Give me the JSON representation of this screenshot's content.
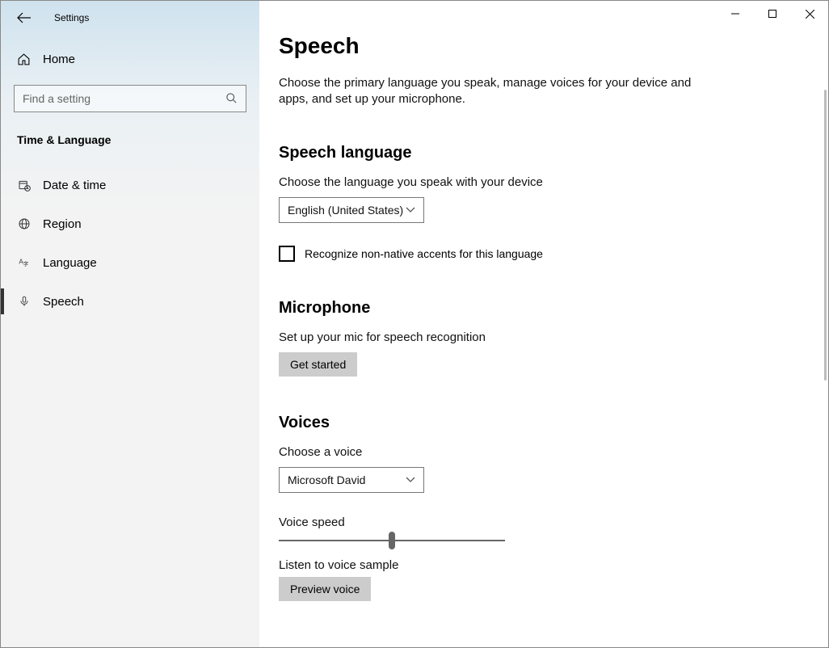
{
  "app": {
    "title": "Settings"
  },
  "sidebar": {
    "home": "Home",
    "search_placeholder": "Find a setting",
    "category": "Time & Language",
    "items": [
      {
        "label": "Date & time",
        "icon": "calendar-clock-icon",
        "selected": false
      },
      {
        "label": "Region",
        "icon": "globe-icon",
        "selected": false
      },
      {
        "label": "Language",
        "icon": "language-character-icon",
        "selected": false
      },
      {
        "label": "Speech",
        "icon": "microphone-icon",
        "selected": true
      }
    ]
  },
  "page": {
    "title": "Speech",
    "description": "Choose the primary language you speak, manage voices for your device and apps, and set up your microphone."
  },
  "speech_language": {
    "heading": "Speech language",
    "subtext": "Choose the language you speak with your device",
    "selected": "English (United States)",
    "checkbox_label": "Recognize non-native accents for this language",
    "checkbox_checked": false
  },
  "microphone": {
    "heading": "Microphone",
    "subtext": "Set up your mic for speech recognition",
    "button": "Get started"
  },
  "voices": {
    "heading": "Voices",
    "choose_label": "Choose a voice",
    "selected": "Microsoft David",
    "speed_label": "Voice speed",
    "speed_value": 50,
    "sample_label": "Listen to voice sample",
    "preview_button": "Preview voice"
  }
}
